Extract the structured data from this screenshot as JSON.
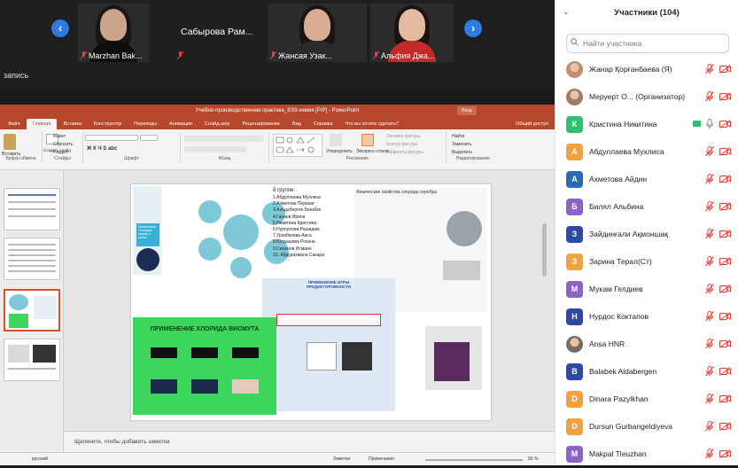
{
  "video_strip": {
    "tiles": [
      {
        "name": "Marzhan Bak..."
      },
      {
        "name": ""
      },
      {
        "name": "Жансая Узак..."
      },
      {
        "name": "Альфия Джа..."
      }
    ],
    "center_name": "Сабырова Рам...",
    "recording_label": "запись"
  },
  "powerpoint": {
    "title": "Учебно-производственная практика_8ЭЗ-химия [Р/Р] - PowerPoint",
    "account": "Вход",
    "tabs": [
      "Файл",
      "Главная",
      "Вставка",
      "Конструктор",
      "Переходы",
      "Анимация",
      "Слайд-шоу",
      "Рецензирование",
      "Вид",
      "Справка",
      "Что вы хотите сделать?"
    ],
    "share": "Общий доступ",
    "ribbon": {
      "clipboard": "Буфер обмена",
      "slides": "Слайды",
      "font": "Шрифт",
      "paragraph": "Абзац",
      "drawing": "Рисование",
      "editing": "Редактирование",
      "paste": "Вставить",
      "create_slide": "Создать слайд",
      "layout": "Макет",
      "reset": "Сбросить",
      "section": "Раздел",
      "arrange": "Упорядочить",
      "quick_styles": "Экспресс-стили",
      "shape_fill": "Заливка фигуры",
      "shape_outline": "Контур фигуры",
      "shape_effects": "Эффекты фигуры",
      "find": "Найти",
      "replace": "Заменить",
      "select": "Выделить"
    },
    "notes_placeholder": "Щелкните, чтобы добавить заметки",
    "status": {
      "language": "русский",
      "notes": "Заметки",
      "comments": "Примечания",
      "zoom": "65 %"
    },
    "slide": {
      "group_title": "8 группе:",
      "group_members": [
        "1.Абдуллаева Мухлиса",
        "2.Ахметова Перизат",
        "3.Альдабергин Бекзбек",
        "4.Ганаев Ирина",
        "5.Никитина Кристина",
        "6.Нурпулова Рашидам",
        "7.Урзабекова Аиса",
        "8.Юлдашева Розана",
        "9.Сиоенов Исмаин",
        "10. Абдурахмана Сакара"
      ],
      "phys_title": "Физические свойства хлорида серебра",
      "application_title": "ПРИМЕНЕНИЕ ХЛОРИДА ВИСМУТА",
      "game_title": "ПРИМЕНЕНИЕ ИГРЫ ПРЕДИКТОРОВНОСТИ",
      "left_banner": "Применение хлоридов натрия и калия"
    }
  },
  "participants": {
    "title": "Участники (104)",
    "search_placeholder": "Найти участника",
    "list": [
      {
        "name": "Жанар Қорғанбаева (Я)",
        "avatar": "photo",
        "color": "#c58b6a"
      },
      {
        "name": "Меруерт О... (Организатор)",
        "avatar": "photo",
        "color": "#a47a60"
      },
      {
        "name": "Кристина Никитина",
        "avatar": "К",
        "color": "#2fbf71"
      },
      {
        "name": "Абдуллаева Мухлиса",
        "avatar": "А",
        "color": "#f0a33c"
      },
      {
        "name": "Ахметова Айдин",
        "avatar": "А",
        "color": "#2c69b5"
      },
      {
        "name": "Билял Альбина",
        "avatar": "Б",
        "color": "#8b62c8"
      },
      {
        "name": "Зайдинғали Ақмоншақ",
        "avatar": "З",
        "color": "#2c4aa5"
      },
      {
        "name": "Зарина Терал(Ст)",
        "avatar": "З",
        "color": "#f0a33c"
      },
      {
        "name": "Мукам Гелдиев",
        "avatar": "М",
        "color": "#8b62c8"
      },
      {
        "name": "Нурдос Коктапов",
        "avatar": "Н",
        "color": "#2c4aa5"
      },
      {
        "name": "Ansa HNR",
        "avatar": "photo",
        "color": "#7a6a5a"
      },
      {
        "name": "Balabek Aldabergen",
        "avatar": "B",
        "color": "#2c4aa5"
      },
      {
        "name": "Dinara Pazylkhan",
        "avatar": "D",
        "color": "#f0a33c"
      },
      {
        "name": "Dursun Gurbangeldiyeva",
        "avatar": "D",
        "color": "#f0a33c"
      },
      {
        "name": "Makpal Tleuzhan",
        "avatar": "M",
        "color": "#8b62c8"
      }
    ]
  },
  "colors": {
    "accent": "#2d7be5",
    "ppt_red": "#b7472a",
    "muted_red": "#e0413a"
  }
}
